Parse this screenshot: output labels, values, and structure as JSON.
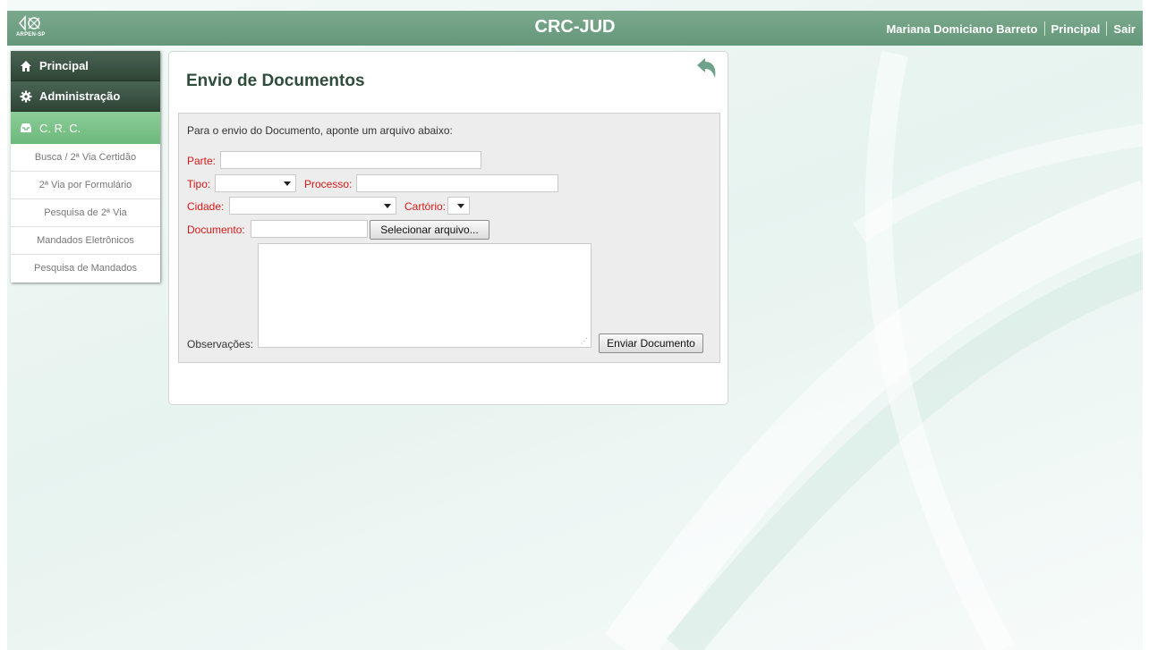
{
  "header": {
    "logo_text": "ARPEN-SP",
    "title": "CRC-JUD",
    "user_name": "Mariana Domiciano Barreto",
    "nav_principal": "Principal",
    "nav_sair": "Sair"
  },
  "sidebar": {
    "main_items": [
      {
        "label": "Principal",
        "icon": "home-icon"
      },
      {
        "label": "Administração",
        "icon": "gear-icon"
      },
      {
        "label": "C. R. C.",
        "icon": "inbox-icon"
      }
    ],
    "sub_items": [
      {
        "label": "Busca / 2ª Via Certidão"
      },
      {
        "label": "2ª Via por Formulário"
      },
      {
        "label": "Pesquisa de 2ª Via"
      },
      {
        "label": "Mandados Eletrônicos"
      },
      {
        "label": "Pesquisa de Mandados"
      }
    ]
  },
  "panel": {
    "title": "Envio de Documentos",
    "back_icon": "back-arrow-icon",
    "form": {
      "intro": "Para o envio do Documento, aponte um arquivo abaixo:",
      "parte_label": "Parte:",
      "parte_value": "",
      "tipo_label": "Tipo:",
      "tipo_value": "",
      "processo_label": "Processo:",
      "processo_value": "",
      "cidade_label": "Cidade:",
      "cidade_value": "",
      "cartorio_label": "Cartório:",
      "cartorio_value": "",
      "documento_label": "Documento:",
      "documento_value": "",
      "select_file_button": "Selecionar arquivo...",
      "observacoes_label": "Observações:",
      "observacoes_value": "",
      "submit_button": "Enviar Documento"
    }
  },
  "colors": {
    "header_green": "#6f9f83",
    "sidebar_dark": "#3a5444",
    "sidebar_active": "#7cc48b",
    "title_green": "#2f4d3c",
    "required_red": "#d61818"
  }
}
